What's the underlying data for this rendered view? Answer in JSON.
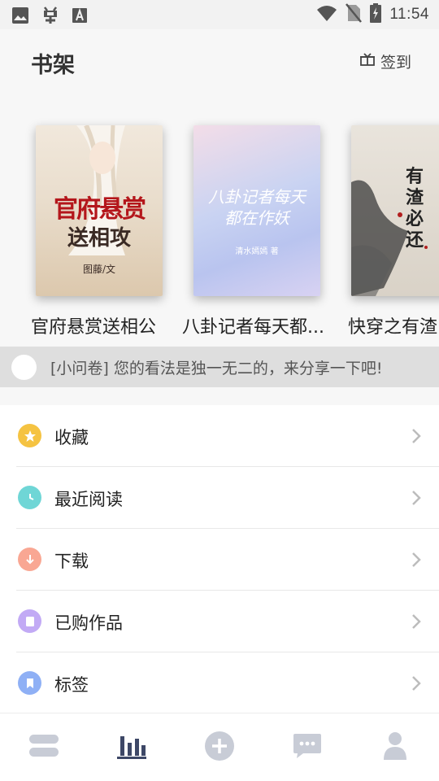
{
  "status_bar": {
    "time": "11:54",
    "icons": [
      "image-icon",
      "bug-icon",
      "text-a-icon",
      "wifi-icon",
      "no-sim-icon",
      "battery-icon"
    ]
  },
  "header": {
    "title": "书架",
    "checkin_label": "签到"
  },
  "shelf": {
    "books": [
      {
        "title": "官府悬赏送相公",
        "cover_text_1": "官府悬赏",
        "cover_text_2": "送相攻",
        "cover_author": "图藤/文"
      },
      {
        "title": "八卦记者每天都...",
        "cover_text_1": "八卦记者每天",
        "cover_text_2": "都在作妖",
        "cover_author": "清水嫣嫣 著"
      },
      {
        "title": "快穿之有渣",
        "cover_text_1": "有渣必还",
        "cover_text_2": "",
        "cover_author": ""
      }
    ]
  },
  "notice": {
    "text": "[小问卷] 您的看法是独一无二的，来分享一下吧!"
  },
  "menu": {
    "items": [
      {
        "label": "收藏",
        "icon": "star-icon",
        "color": "#f5c342"
      },
      {
        "label": "最近阅读",
        "icon": "clock-icon",
        "color": "#6fd6d6"
      },
      {
        "label": "下载",
        "icon": "download-icon",
        "color": "#f9a793"
      },
      {
        "label": "已购作品",
        "icon": "book-icon",
        "color": "#c2aaf5"
      },
      {
        "label": "标签",
        "icon": "bookmark-icon",
        "color": "#8fb0f5"
      }
    ]
  },
  "bottom_nav": {
    "items": [
      {
        "name": "bookshelf-tab",
        "icon": "stack-icon",
        "active": false
      },
      {
        "name": "ranking-tab",
        "icon": "bar-chart-icon",
        "active": true
      },
      {
        "name": "add-tab",
        "icon": "plus-circle-icon",
        "active": false
      },
      {
        "name": "messages-tab",
        "icon": "chat-icon",
        "active": false
      },
      {
        "name": "profile-tab",
        "icon": "person-icon",
        "active": false
      }
    ],
    "active_color": "#3d4766",
    "inactive_color": "#c8ccd6"
  }
}
